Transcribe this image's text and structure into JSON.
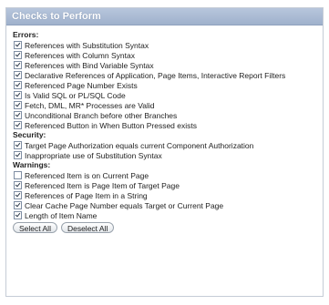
{
  "panel": {
    "title": "Checks to Perform"
  },
  "sections": [
    {
      "title": "Errors:",
      "items": [
        {
          "label": "References with Substitution Syntax",
          "checked": true
        },
        {
          "label": "References with Column Syntax",
          "checked": true
        },
        {
          "label": "References with Bind Variable Syntax",
          "checked": true
        },
        {
          "label": "Declarative References of Application, Page Items, Interactive Report Filters",
          "checked": true
        },
        {
          "label": "Referenced Page Number Exists",
          "checked": true
        },
        {
          "label": "Is Valid SQL or PL/SQL Code",
          "checked": true
        },
        {
          "label": "Fetch, DML, MR* Processes are Valid",
          "checked": true
        },
        {
          "label": "Unconditional Branch before other Branches",
          "checked": true
        },
        {
          "label": "Referenced Button in When Button Pressed exists",
          "checked": true
        }
      ]
    },
    {
      "title": "Security:",
      "items": [
        {
          "label": "Target Page Authorization equals current Component Authorization",
          "checked": true
        },
        {
          "label": "Inappropriate use of Substitution Syntax",
          "checked": true
        }
      ]
    },
    {
      "title": "Warnings:",
      "items": [
        {
          "label": "Referenced Item is on Current Page",
          "checked": false
        },
        {
          "label": "Referenced Item is Page Item of Target Page",
          "checked": true
        },
        {
          "label": "References of Page Item in a String",
          "checked": true
        },
        {
          "label": "Clear Cache Page Number equals Target or Current Page",
          "checked": true
        },
        {
          "label": "Length of Item Name",
          "checked": true
        }
      ]
    }
  ],
  "buttons": {
    "select_all": "Select All",
    "deselect_all": "Deselect All"
  }
}
